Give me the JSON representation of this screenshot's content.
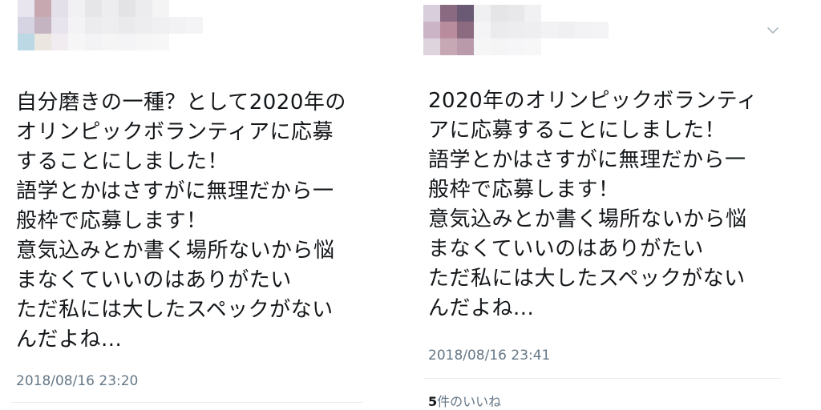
{
  "left_tweet": {
    "text": "自分磨きの一種？として2020年の\nオリンピックボランティアに応募\nすることにしました！\n語学とかはさすがに無理だから一\n般枠で応募します！\n意気込みとか書く場所ないから悩\nまなくていいのはありがたい\nただ私には大したスペックがない\nんだよね...",
    "timestamp": "2018/08/16 23:20"
  },
  "right_tweet": {
    "text": "2020年のオリンピックボランティ\nアに応募することにしました！\n語学とかはさすがに無理だから一\n般枠で応募します！\n意気込みとか書く場所ないから悩\nまなくていいのはありがたい\nただ私には大したスペックがない\nんだよね...",
    "timestamp": "2018/08/16 23:41",
    "likes_count": "5",
    "likes_label": "件のいいね",
    "menu_icon": "chevron-down-icon"
  },
  "colors": {
    "text": "#14171a",
    "meta": "#657786",
    "divider": "#e6ecf0"
  }
}
